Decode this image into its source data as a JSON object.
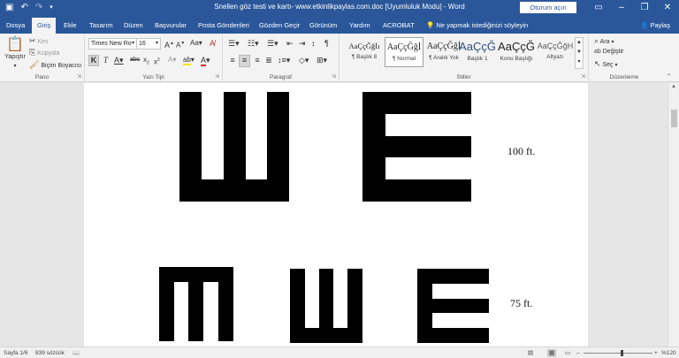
{
  "window": {
    "title": "Snellen göz testi ve kartı- www.etkinlikpaylas.com.doc [Uyumluluk Modu]  -  Word",
    "sign_in": "Oturum açın"
  },
  "tabs": [
    "Dosya",
    "Giriş",
    "Ekle",
    "Tasarım",
    "Düzen",
    "Başvurular",
    "Posta Gönderileri",
    "Gözden Geçir",
    "Görünüm",
    "Yardım",
    "ACROBAT"
  ],
  "active_tab": "Giriş",
  "tell_me": "Ne yapmak istediğinizi söyleyin",
  "share": "Paylaş",
  "ribbon": {
    "clipboard": {
      "paste": "Yapıştır",
      "cut": "Kes",
      "copy": "Kopyala",
      "format_painter": "Biçim Boyacısı",
      "label": "Pano"
    },
    "font": {
      "name": "Times New Ro",
      "size": "16",
      "label": "Yazı Tipi"
    },
    "paragraph": {
      "label": "Paragraf"
    },
    "styles": {
      "items": [
        {
          "sample": "AaÇçĞğİı",
          "name": "¶ Başlık 8"
        },
        {
          "sample": "AaÇçĞğİ",
          "name": "¶ Normal"
        },
        {
          "sample": "AaÇçĞğİ",
          "name": "¶ Aralık Yok"
        },
        {
          "sample": "AaÇçĞ",
          "name": "Başlık 1"
        },
        {
          "sample": "AaÇçĞ",
          "name": "Konu Başlığı"
        },
        {
          "sample": "AaÇçĞğH",
          "name": "Altyazı"
        }
      ],
      "label": "Stiller"
    },
    "editing": {
      "find": "Ara",
      "replace": "Değiştir",
      "select": "Seç",
      "label": "Düzenleme"
    }
  },
  "document": {
    "rows": [
      {
        "label": "100 ft."
      },
      {
        "label": "75 ft."
      }
    ]
  },
  "status": {
    "page": "Sayfa 1/6",
    "words": "839 sözcük",
    "zoom": "%120",
    "zoom_level": 0.55
  }
}
